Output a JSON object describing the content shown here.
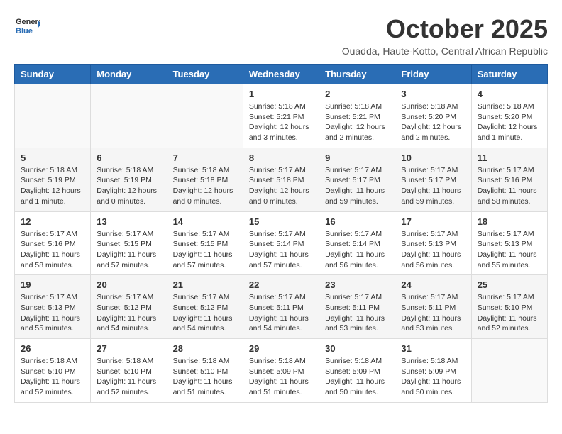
{
  "logo": {
    "general": "General",
    "blue": "Blue"
  },
  "title": "October 2025",
  "subtitle": "Ouadda, Haute-Kotto, Central African Republic",
  "days_header": [
    "Sunday",
    "Monday",
    "Tuesday",
    "Wednesday",
    "Thursday",
    "Friday",
    "Saturday"
  ],
  "weeks": [
    [
      {
        "day": "",
        "info": ""
      },
      {
        "day": "",
        "info": ""
      },
      {
        "day": "",
        "info": ""
      },
      {
        "day": "1",
        "info": "Sunrise: 5:18 AM\nSunset: 5:21 PM\nDaylight: 12 hours\nand 3 minutes."
      },
      {
        "day": "2",
        "info": "Sunrise: 5:18 AM\nSunset: 5:21 PM\nDaylight: 12 hours\nand 2 minutes."
      },
      {
        "day": "3",
        "info": "Sunrise: 5:18 AM\nSunset: 5:20 PM\nDaylight: 12 hours\nand 2 minutes."
      },
      {
        "day": "4",
        "info": "Sunrise: 5:18 AM\nSunset: 5:20 PM\nDaylight: 12 hours\nand 1 minute."
      }
    ],
    [
      {
        "day": "5",
        "info": "Sunrise: 5:18 AM\nSunset: 5:19 PM\nDaylight: 12 hours\nand 1 minute."
      },
      {
        "day": "6",
        "info": "Sunrise: 5:18 AM\nSunset: 5:19 PM\nDaylight: 12 hours\nand 0 minutes."
      },
      {
        "day": "7",
        "info": "Sunrise: 5:18 AM\nSunset: 5:18 PM\nDaylight: 12 hours\nand 0 minutes."
      },
      {
        "day": "8",
        "info": "Sunrise: 5:17 AM\nSunset: 5:18 PM\nDaylight: 12 hours\nand 0 minutes."
      },
      {
        "day": "9",
        "info": "Sunrise: 5:17 AM\nSunset: 5:17 PM\nDaylight: 11 hours\nand 59 minutes."
      },
      {
        "day": "10",
        "info": "Sunrise: 5:17 AM\nSunset: 5:17 PM\nDaylight: 11 hours\nand 59 minutes."
      },
      {
        "day": "11",
        "info": "Sunrise: 5:17 AM\nSunset: 5:16 PM\nDaylight: 11 hours\nand 58 minutes."
      }
    ],
    [
      {
        "day": "12",
        "info": "Sunrise: 5:17 AM\nSunset: 5:16 PM\nDaylight: 11 hours\nand 58 minutes."
      },
      {
        "day": "13",
        "info": "Sunrise: 5:17 AM\nSunset: 5:15 PM\nDaylight: 11 hours\nand 57 minutes."
      },
      {
        "day": "14",
        "info": "Sunrise: 5:17 AM\nSunset: 5:15 PM\nDaylight: 11 hours\nand 57 minutes."
      },
      {
        "day": "15",
        "info": "Sunrise: 5:17 AM\nSunset: 5:14 PM\nDaylight: 11 hours\nand 57 minutes."
      },
      {
        "day": "16",
        "info": "Sunrise: 5:17 AM\nSunset: 5:14 PM\nDaylight: 11 hours\nand 56 minutes."
      },
      {
        "day": "17",
        "info": "Sunrise: 5:17 AM\nSunset: 5:13 PM\nDaylight: 11 hours\nand 56 minutes."
      },
      {
        "day": "18",
        "info": "Sunrise: 5:17 AM\nSunset: 5:13 PM\nDaylight: 11 hours\nand 55 minutes."
      }
    ],
    [
      {
        "day": "19",
        "info": "Sunrise: 5:17 AM\nSunset: 5:13 PM\nDaylight: 11 hours\nand 55 minutes."
      },
      {
        "day": "20",
        "info": "Sunrise: 5:17 AM\nSunset: 5:12 PM\nDaylight: 11 hours\nand 54 minutes."
      },
      {
        "day": "21",
        "info": "Sunrise: 5:17 AM\nSunset: 5:12 PM\nDaylight: 11 hours\nand 54 minutes."
      },
      {
        "day": "22",
        "info": "Sunrise: 5:17 AM\nSunset: 5:11 PM\nDaylight: 11 hours\nand 54 minutes."
      },
      {
        "day": "23",
        "info": "Sunrise: 5:17 AM\nSunset: 5:11 PM\nDaylight: 11 hours\nand 53 minutes."
      },
      {
        "day": "24",
        "info": "Sunrise: 5:17 AM\nSunset: 5:11 PM\nDaylight: 11 hours\nand 53 minutes."
      },
      {
        "day": "25",
        "info": "Sunrise: 5:17 AM\nSunset: 5:10 PM\nDaylight: 11 hours\nand 52 minutes."
      }
    ],
    [
      {
        "day": "26",
        "info": "Sunrise: 5:18 AM\nSunset: 5:10 PM\nDaylight: 11 hours\nand 52 minutes."
      },
      {
        "day": "27",
        "info": "Sunrise: 5:18 AM\nSunset: 5:10 PM\nDaylight: 11 hours\nand 52 minutes."
      },
      {
        "day": "28",
        "info": "Sunrise: 5:18 AM\nSunset: 5:10 PM\nDaylight: 11 hours\nand 51 minutes."
      },
      {
        "day": "29",
        "info": "Sunrise: 5:18 AM\nSunset: 5:09 PM\nDaylight: 11 hours\nand 51 minutes."
      },
      {
        "day": "30",
        "info": "Sunrise: 5:18 AM\nSunset: 5:09 PM\nDaylight: 11 hours\nand 50 minutes."
      },
      {
        "day": "31",
        "info": "Sunrise: 5:18 AM\nSunset: 5:09 PM\nDaylight: 11 hours\nand 50 minutes."
      },
      {
        "day": "",
        "info": ""
      }
    ]
  ]
}
